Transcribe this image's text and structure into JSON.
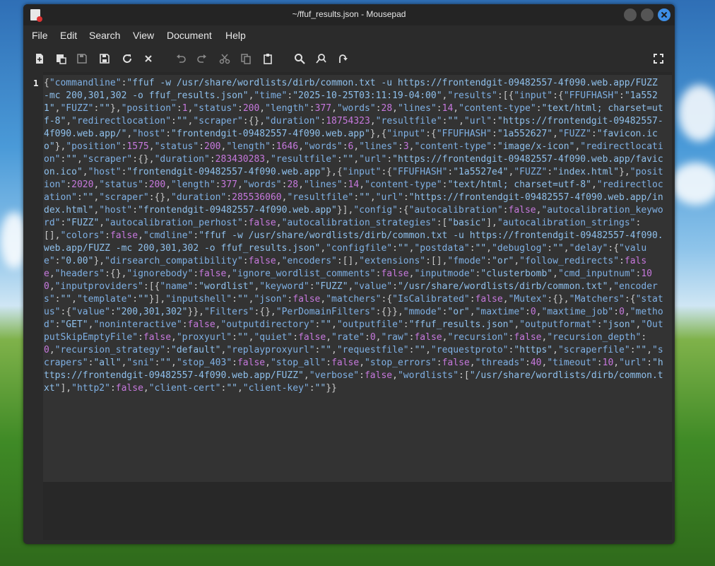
{
  "window": {
    "title": "~/ffuf_results.json - Mousepad"
  },
  "menubar": {
    "items": [
      "File",
      "Edit",
      "Search",
      "View",
      "Document",
      "Help"
    ]
  },
  "toolbar": {
    "icons": [
      "new-document-icon",
      "new-window-icon",
      "save-icon",
      "save-as-icon",
      "reload-icon",
      "close-document-icon",
      "undo-icon",
      "redo-icon",
      "cut-icon",
      "copy-icon",
      "paste-icon",
      "search-icon",
      "find-replace-icon",
      "go-to-line-icon",
      "fullscreen-icon"
    ]
  },
  "editor": {
    "line_number": "1",
    "content": "{\"commandline\":\"ffuf -w /usr/share/wordlists/dirb/common.txt -u https://frontendgit-09482557-4f090.web.app/FUZZ -mc 200,301,302 -o ffuf_results.json\",\"time\":\"2025-10-25T03:11:19-04:00\",\"results\":[{\"input\":{\"FFUFHASH\":\"1a5521\",\"FUZZ\":\"\"},\"position\":1,\"status\":200,\"length\":377,\"words\":28,\"lines\":14,\"content-type\":\"text/html; charset=utf-8\",\"redirectlocation\":\"\",\"scraper\":{},\"duration\":18754323,\"resultfile\":\"\",\"url\":\"https://frontendgit-09482557-4f090.web.app/\",\"host\":\"frontendgit-09482557-4f090.web.app\"},{\"input\":{\"FFUFHASH\":\"1a552627\",\"FUZZ\":\"favicon.ico\"},\"position\":1575,\"status\":200,\"length\":1646,\"words\":6,\"lines\":3,\"content-type\":\"image/x-icon\",\"redirectlocation\":\"\",\"scraper\":{},\"duration\":283430283,\"resultfile\":\"\",\"url\":\"https://frontendgit-09482557-4f090.web.app/favicon.ico\",\"host\":\"frontendgit-09482557-4f090.web.app\"},{\"input\":{\"FFUFHASH\":\"1a5527e4\",\"FUZZ\":\"index.html\"},\"position\":2020,\"status\":200,\"length\":377,\"words\":28,\"lines\":14,\"content-type\":\"text/html; charset=utf-8\",\"redirectlocation\":\"\",\"scraper\":{},\"duration\":285536060,\"resultfile\":\"\",\"url\":\"https://frontendgit-09482557-4f090.web.app/index.html\",\"host\":\"frontendgit-09482557-4f090.web.app\"}],\"config\":{\"autocalibration\":false,\"autocalibration_keyword\":\"FUZZ\",\"autocalibration_perhost\":false,\"autocalibration_strategies\":[\"basic\"],\"autocalibration_strings\":[],\"colors\":false,\"cmdline\":\"ffuf -w /usr/share/wordlists/dirb/common.txt -u https://frontendgit-09482557-4f090.web.app/FUZZ -mc 200,301,302 -o ffuf_results.json\",\"configfile\":\"\",\"postdata\":\"\",\"debuglog\":\"\",\"delay\":{\"value\":\"0.00\"},\"dirsearch_compatibility\":false,\"encoders\":[],\"extensions\":[],\"fmode\":\"or\",\"follow_redirects\":false,\"headers\":{},\"ignorebody\":false,\"ignore_wordlist_comments\":false,\"inputmode\":\"clusterbomb\",\"cmd_inputnum\":100,\"inputproviders\":[{\"name\":\"wordlist\",\"keyword\":\"FUZZ\",\"value\":\"/usr/share/wordlists/dirb/common.txt\",\"encoders\":\"\",\"template\":\"\"}],\"inputshell\":\"\",\"json\":false,\"matchers\":{\"IsCalibrated\":false,\"Mutex\":{},\"Matchers\":{\"status\":{\"value\":\"200,301,302\"}},\"Filters\":{},\"PerDomainFilters\":{}},\"mmode\":\"or\",\"maxtime\":0,\"maxtime_job\":0,\"method\":\"GET\",\"noninteractive\":false,\"outputdirectory\":\"\",\"outputfile\":\"ffuf_results.json\",\"outputformat\":\"json\",\"OutputSkipEmptyFile\":false,\"proxyurl\":\"\",\"quiet\":false,\"rate\":0,\"raw\":false,\"recursion\":false,\"recursion_depth\":0,\"recursion_strategy\":\"default\",\"replayproxyurl\":\"\",\"requestfile\":\"\",\"requestproto\":\"https\",\"scraperfile\":\"\",\"scrapers\":\"all\",\"sni\":\"\",\"stop_403\":false,\"stop_all\":false,\"stop_errors\":false,\"threads\":40,\"timeout\":10,\"url\":\"https://frontendgit-09482557-4f090.web.app/FUZZ\",\"verbose\":false,\"wordlists\":[\"/usr/share/wordlists/dirb/common.txt\"],\"http2\":false,\"client-cert\":\"\",\"client-key\":\"\"}}"
  },
  "colors": {
    "key": "#7fb0e4",
    "string": "#8fc0ec",
    "number": "#c678dd",
    "accent": "#3d8ee6"
  }
}
